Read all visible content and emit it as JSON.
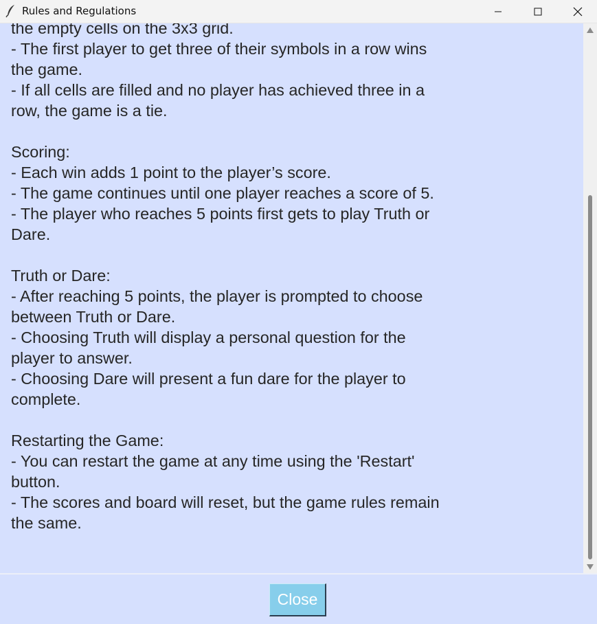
{
  "window": {
    "title": "Rules and Regulations",
    "app_icon": "feather-icon",
    "controls": [
      "minimize-icon",
      "maximize-icon",
      "close-icon"
    ]
  },
  "rules": {
    "lines": [
      "the empty cells on the 3x3 grid.",
      "- The first player to get three of their symbols in a row wins",
      "the game.",
      "- If all cells are filled and no player has achieved three in a",
      "row, the game is a tie.",
      "",
      "Scoring:",
      "- Each win adds 1 point to the player’s score.",
      "- The game continues until one player reaches a score of 5.",
      "- The player who reaches 5 points first gets to play Truth or",
      "Dare.",
      "",
      "Truth or Dare:",
      "- After reaching 5 points, the player is prompted to choose",
      "between Truth or Dare.",
      "- Choosing Truth will display a personal question for the",
      "player to answer.",
      "- Choosing Dare will present a fun dare for the player to",
      "complete.",
      "",
      "Restarting the Game:",
      "- You can restart the game at any time using the 'Restart'",
      "button.",
      "- The scores and board will reset, but the game rules remain",
      "the same."
    ]
  },
  "footer": {
    "close_label": "Close"
  },
  "colors": {
    "background": "#d6e0fe",
    "button": "#87ceeb",
    "text": "#262626"
  }
}
